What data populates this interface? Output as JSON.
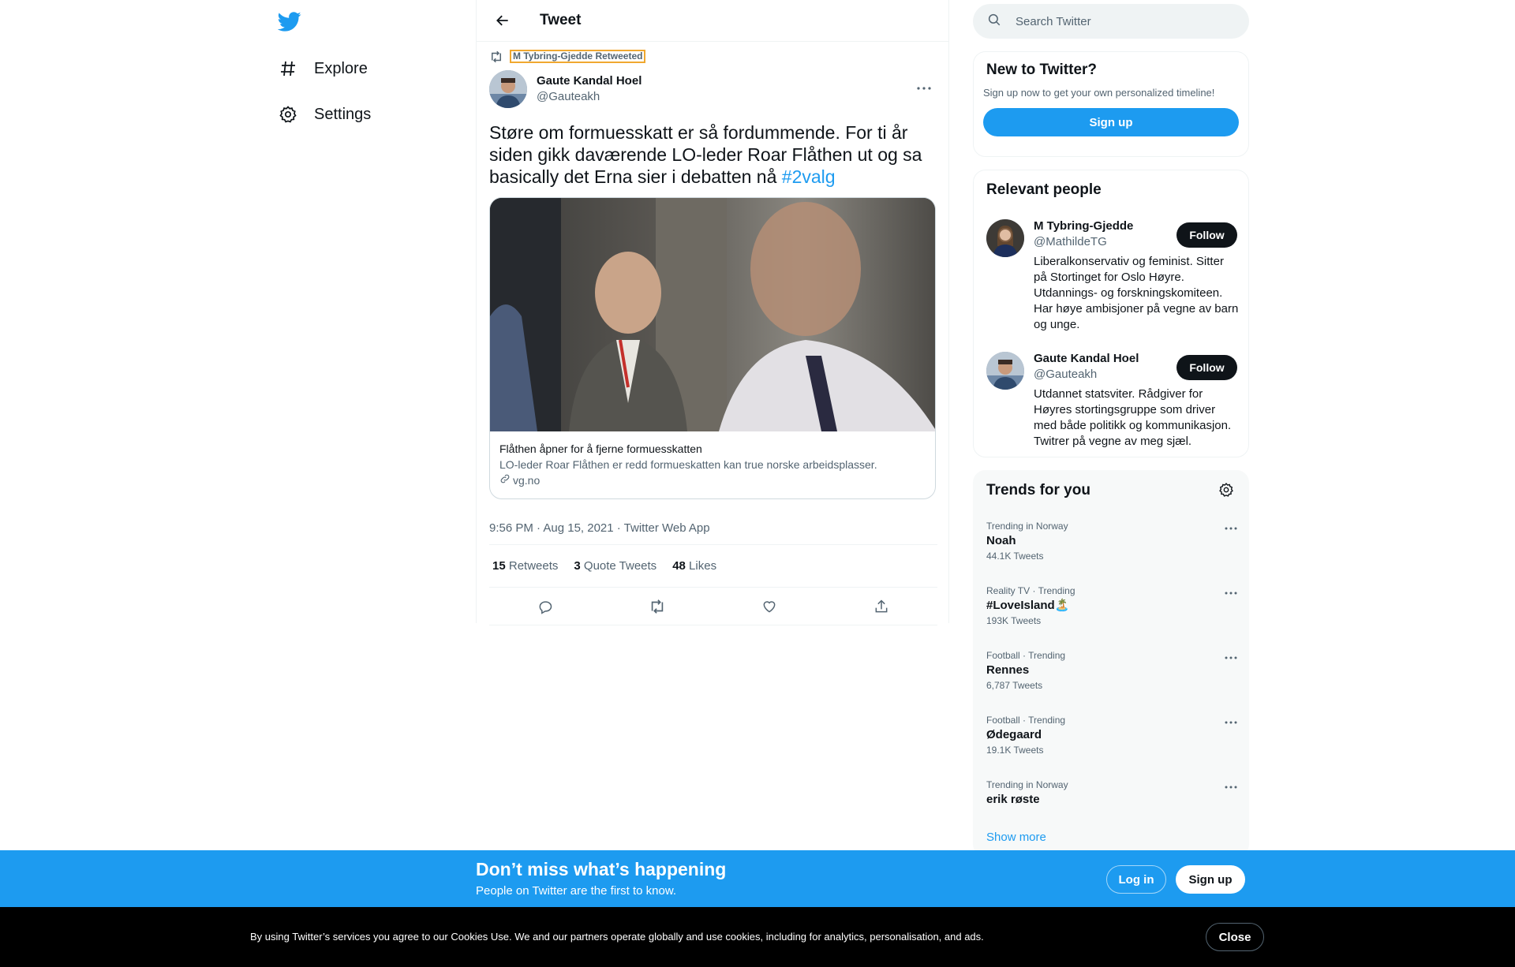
{
  "nav": {
    "logo": "twitter-bird-icon",
    "items": [
      {
        "label": "Explore",
        "icon": "hashtag-icon"
      },
      {
        "label": "Settings",
        "icon": "gear-icon"
      }
    ]
  },
  "header": {
    "title": "Tweet"
  },
  "tweet": {
    "retweeted_by": "M Tybring-Gjedde Retweeted",
    "author_name": "Gaute Kandal Hoel",
    "author_handle": "@Gauteakh",
    "text_main": "Støre om formuesskatt er så fordummende. For ti år siden gikk daværende LO-leder Roar Flåthen ut og sa basically det Erna sier i debatten nå ",
    "hashtag": "#2valg",
    "card": {
      "title": "Flåthen åpner for å fjerne formuesskatten",
      "description": "LO-leder Roar Flåthen er redd formueskatten kan true norske arbeidsplasser.",
      "domain": "vg.no"
    },
    "meta": "9:56 PM · Aug 15, 2021 · Twitter Web App",
    "stats": {
      "retweets_count": "15",
      "retweets_label": "Retweets",
      "quotes_count": "3",
      "quotes_label": "Quote Tweets",
      "likes_count": "48",
      "likes_label": "Likes"
    }
  },
  "search": {
    "placeholder": "Search Twitter"
  },
  "new_to_twitter": {
    "title": "New to Twitter?",
    "subtitle": "Sign up now to get your own personalized timeline!",
    "button": "Sign up"
  },
  "relevant_people": {
    "title": "Relevant people",
    "people": [
      {
        "name": "M Tybring-Gjedde",
        "handle": "@MathildeTG",
        "bio": "Liberalkonservativ og feminist. Sitter på Stortinget for Oslo Høyre. Utdannings- og forskningskomiteen. Har høye ambisjoner på vegne av barn og unge.",
        "button": "Follow"
      },
      {
        "name": "Gaute Kandal Hoel",
        "handle": "@Gauteakh",
        "bio": "Utdannet statsviter. Rådgiver for Høyres stortingsgruppe som driver med både politikk og kommunikasjon. Twitrer på vegne av meg sjæl.",
        "button": "Follow"
      }
    ]
  },
  "trends": {
    "title": "Trends for you",
    "items": [
      {
        "context": "Trending in Norway",
        "name": "Noah",
        "count": "44.1K Tweets"
      },
      {
        "context": "Reality TV · Trending",
        "name": "#LoveIsland🏝️",
        "count": "193K Tweets"
      },
      {
        "context": "Football · Trending",
        "name": "Rennes",
        "count": "6,787 Tweets"
      },
      {
        "context": "Football · Trending",
        "name": "Ødegaard",
        "count": "19.1K Tweets"
      },
      {
        "context": "Trending in Norway",
        "name": "erik røste",
        "count": ""
      }
    ],
    "show_more": "Show more"
  },
  "signup_bar": {
    "title": "Don’t miss what’s happening",
    "subtitle": "People on Twitter are the first to know.",
    "login": "Log in",
    "signup": "Sign up"
  },
  "cookie_bar": {
    "text": "By using Twitter’s services you agree to our Cookies Use. We and our partners operate globally and use cookies, including for analytics, personalisation, and ads.",
    "close": "Close"
  },
  "colors": {
    "accent": "#1d9bf0",
    "text": "#0f1419",
    "muted": "#536471"
  }
}
